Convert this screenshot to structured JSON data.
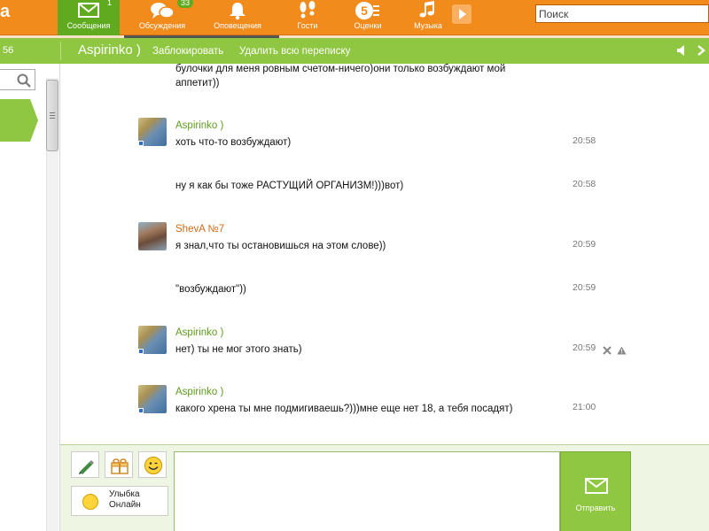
{
  "topbar": {
    "brand": "а",
    "nav": [
      {
        "label": "Сообщения",
        "badge": "1",
        "icon": "envelope-icon",
        "active": true
      },
      {
        "label": "Обсуждения",
        "badge": "33",
        "icon": "chat-bubbles-icon"
      },
      {
        "label": "Оповещения",
        "icon": "bell-icon"
      },
      {
        "label": "Гости",
        "icon": "footprints-icon"
      },
      {
        "label": "Оценки",
        "icon": "rating-five-icon"
      },
      {
        "label": "Музыка",
        "icon": "music-note-icon"
      }
    ],
    "search_value": "Поиск"
  },
  "header": {
    "count": "56",
    "contact_name": "Aspirinko )",
    "block_label": "Заблокировать",
    "delete_label": "Удалить всю переписку"
  },
  "colors": {
    "orange": "#f08b1c",
    "green": "#8fc742",
    "author_green": "#5e9c1d",
    "author_orange": "#cc6a17",
    "online_blue": "#2d6fd0"
  },
  "messages": {
    "m0": {
      "text": "булочки для меня ровным счетом-ничего)они только возбуждают мой аппетит))"
    },
    "m1": {
      "author": "Aspirinko )",
      "text": "хоть что-то возбуждают)",
      "time": "20:58"
    },
    "m2": {
      "text": "ну я как бы тоже РАСТУЩИЙ ОРГАНИЗМ!)))вот)",
      "time": "20:58"
    },
    "m3": {
      "author": "ShevA №7",
      "text": "я знал,что ты остановишься на этом слове))",
      "time": "20:59"
    },
    "m4": {
      "text": "\"возбуждают\"))",
      "time": "20:59"
    },
    "m5": {
      "author": "Aspirinko )",
      "text": "нет) ты не мог этого знать)",
      "time": "20:59"
    },
    "m6": {
      "author": "Aspirinko )",
      "text": "какого хрена ты мне подмигиваешь?)))мне еще нет 18, а тебя посадят)",
      "time": "21:00"
    }
  },
  "composer": {
    "status_label": "Улыбка Онлайн",
    "send_label": "Отправить"
  }
}
